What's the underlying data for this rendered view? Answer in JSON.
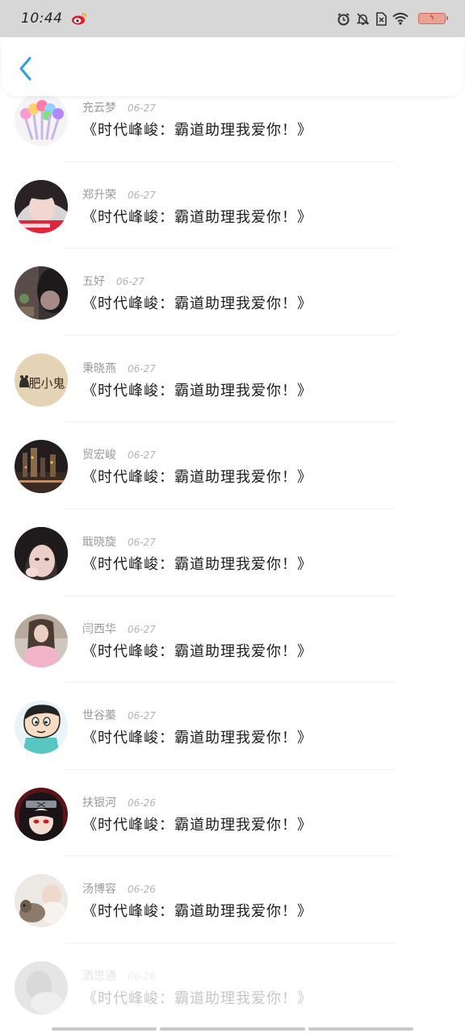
{
  "status_bar": {
    "time": "10:44",
    "weibo_icon": "weibo-icon",
    "icons": [
      "alarm-icon",
      "mute-bell-icon",
      "sim-off-icon",
      "wifi-icon",
      "battery-icon"
    ],
    "battery_color": "#e9a396"
  },
  "header": {
    "back_icon": "chevron-left-icon",
    "accent": "#2a9ee8"
  },
  "rows": [
    {
      "name": "充云梦",
      "date": "06-27",
      "message": "《时代峰峻：霸道助理我爱你！》",
      "avatar": "pom-pom-pens"
    },
    {
      "name": "郑升荣",
      "date": "06-27",
      "message": "《时代峰峻：霸道助理我爱你！》",
      "avatar": "girl-portrait"
    },
    {
      "name": "五好",
      "date": "06-27",
      "message": "《时代峰峻：霸道助理我爱你！》",
      "avatar": "dark-photo"
    },
    {
      "name": "秉晓燕",
      "date": "06-27",
      "message": "《时代峰峻：霸道助理我爱你！》",
      "avatar": "fat-ghost",
      "avatar_text": "肥小鬼"
    },
    {
      "name": "贸宏峻",
      "date": "06-27",
      "message": "《时代峰峻：霸道助理我爱你！》",
      "avatar": "night-city"
    },
    {
      "name": "戢晓旋",
      "date": "06-27",
      "message": "《时代峰峻：霸道助理我爱你！》",
      "avatar": "girl-closeup"
    },
    {
      "name": "闫西华",
      "date": "06-27",
      "message": "《时代峰峻：霸道助理我爱你！》",
      "avatar": "girl-pink"
    },
    {
      "name": "世谷蓁",
      "date": "06-27",
      "message": "《时代峰峻：霸道助理我爱你！》",
      "avatar": "crayon-shin-chan"
    },
    {
      "name": "扶银河",
      "date": "06-26",
      "message": "《时代峰峻：霸道助理我爱你！》",
      "avatar": "anime-ninja"
    },
    {
      "name": "汤博容",
      "date": "06-26",
      "message": "《时代峰峻：霸道助理我爱你！》",
      "avatar": "baby-dog"
    },
    {
      "name": "酒思通",
      "date": "06-26",
      "message": "《时代峰峻：霸道助理我爱你！》",
      "avatar": "faded-photo"
    }
  ]
}
